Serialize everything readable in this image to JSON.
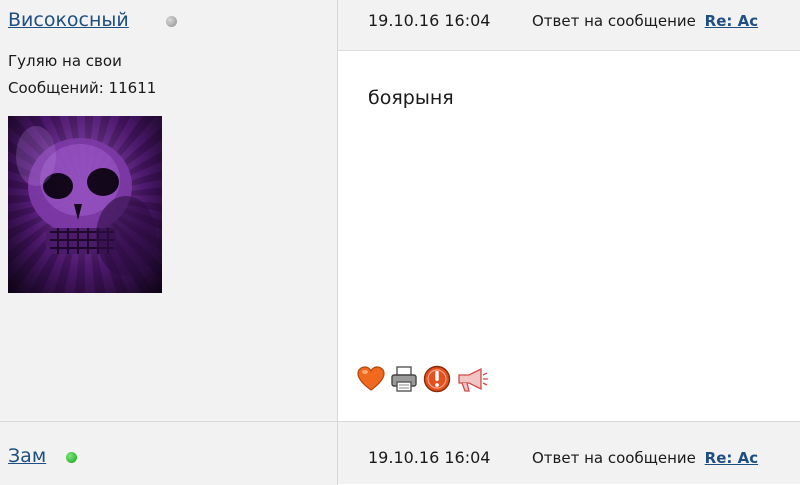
{
  "posts": [
    {
      "author": "Високосный",
      "status": "offline",
      "user_title": "Гуляю на свои",
      "message_count_label": "Сообщений: 11611",
      "date": "19.10.16 16:04",
      "reply_prefix": "Ответ на сообщение",
      "reply_link": "Re: Ac",
      "message": "боярыня",
      "actions": [
        "heart-icon",
        "printer-icon",
        "warning-icon",
        "megaphone-icon"
      ]
    },
    {
      "author": "Зам",
      "status": "online",
      "date": "19.10.16 16:04",
      "reply_prefix": "Ответ на сообщение",
      "reply_link": "Re: Ac"
    }
  ],
  "colors": {
    "link": "#1f4e80",
    "header_bg": "#f2f2f2",
    "online": "#16a016",
    "offline": "#8e8e8e"
  }
}
